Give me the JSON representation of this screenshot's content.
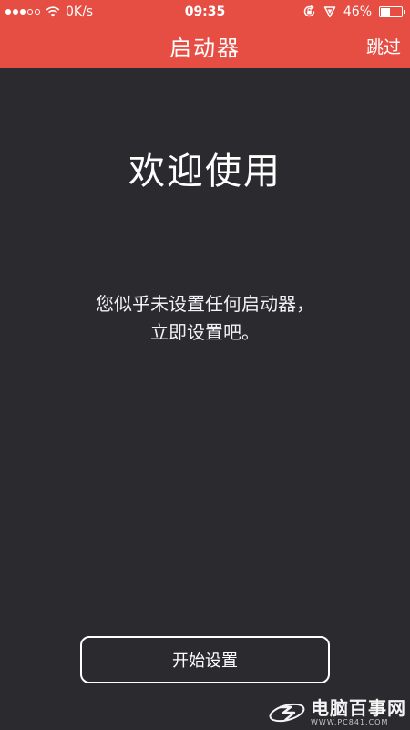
{
  "status_bar": {
    "network_speed": "0K/s",
    "time": "09:35",
    "battery_percent_label": "46%",
    "battery_level": 0.46,
    "signal_bars_filled": 3,
    "signal_bars_total": 5,
    "icons": [
      "signal-dots",
      "wifi-icon",
      "rotation-lock-icon",
      "location-icon",
      "battery-icon"
    ]
  },
  "nav": {
    "title": "启动器",
    "skip_label": "跳过"
  },
  "main": {
    "welcome_title": "欢迎使用",
    "message_line1": "您似乎未设置任何启动器，",
    "message_line2": "立即设置吧。",
    "start_button_label": "开始设置"
  },
  "watermark": {
    "name": "电脑百事网",
    "url": "WWW.PC841.COM",
    "icon": "pc841-logo-icon"
  },
  "colors": {
    "header_red": "#e64d43",
    "background": "#2b2a2f",
    "text": "#ffffff"
  }
}
